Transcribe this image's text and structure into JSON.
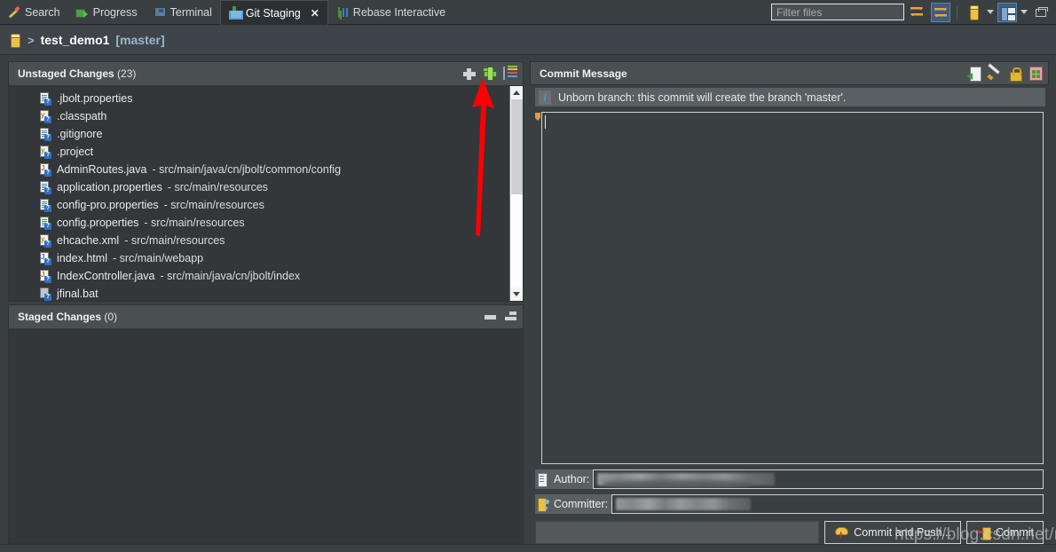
{
  "window": {
    "tabs": [
      {
        "label": "Search",
        "icon": "search-icon",
        "active": false,
        "closable": false
      },
      {
        "label": "Progress",
        "icon": "progress-icon",
        "active": false,
        "closable": false
      },
      {
        "label": "Terminal",
        "icon": "terminal-icon",
        "active": false,
        "closable": false
      },
      {
        "label": "Git Staging",
        "icon": "git-staging-icon",
        "active": true,
        "closable": true,
        "close_label": "✕"
      },
      {
        "label": "Rebase Interactive",
        "icon": "rebase-interactive-icon",
        "active": false,
        "closable": false
      }
    ],
    "toolbar": {
      "filter_placeholder": "Filter files",
      "filter_value": "",
      "buttons": [
        {
          "name": "refresh-sync-icon",
          "label": "Refresh"
        },
        {
          "name": "link-selection-icon",
          "label": "Link with Editor and Selection"
        },
        {
          "name": "repository-icon",
          "label": "Repository"
        },
        {
          "name": "repository-dropdown-caret",
          "label": "Repository menu"
        },
        {
          "name": "layout-toggle-icon",
          "label": "Column Layout"
        },
        {
          "name": "view-menu-caret",
          "label": "View Menu"
        },
        {
          "name": "minimize-icon",
          "label": "Minimize"
        }
      ]
    }
  },
  "breadcrumb": {
    "repo_icon": "repository-icon",
    "separator": ">",
    "repository": "test_demo1",
    "branch": "[master]"
  },
  "unstaged": {
    "title": "Unstaged Changes",
    "count": "(23)",
    "tools": [
      {
        "name": "add-selected-button",
        "label": "Add selected files to index"
      },
      {
        "name": "add-all-button",
        "label": "Add all files to index"
      },
      {
        "name": "sort-presentation-button",
        "label": "Presentation"
      }
    ],
    "files": [
      {
        "name": ".jbolt.properties",
        "path": "",
        "icon": "properties-file-icon",
        "status": "untracked"
      },
      {
        "name": ".classpath",
        "path": "",
        "icon": "xml-file-icon",
        "status": "untracked"
      },
      {
        "name": ".gitignore",
        "path": "",
        "icon": "properties-file-icon",
        "status": "untracked"
      },
      {
        "name": ".project",
        "path": "",
        "icon": "xml-file-icon",
        "status": "untracked"
      },
      {
        "name": "AdminRoutes.java",
        "path": " - src/main/java/cn/jbolt/common/config",
        "icon": "java-file-icon",
        "status": "untracked"
      },
      {
        "name": "application.properties",
        "path": " - src/main/resources",
        "icon": "properties-file-icon",
        "status": "untracked"
      },
      {
        "name": "config-pro.properties",
        "path": " - src/main/resources",
        "icon": "properties-file-icon",
        "status": "untracked"
      },
      {
        "name": "config.properties",
        "path": " - src/main/resources",
        "icon": "properties-file-icon",
        "status": "untracked"
      },
      {
        "name": "ehcache.xml",
        "path": " - src/main/resources",
        "icon": "xml-file-icon",
        "status": "untracked"
      },
      {
        "name": "index.html",
        "path": " - src/main/webapp",
        "icon": "html-file-icon",
        "status": "untracked"
      },
      {
        "name": "IndexController.java",
        "path": " - src/main/java/cn/jbolt/index",
        "icon": "java-file-icon",
        "status": "untracked"
      },
      {
        "name": "jfinal.bat",
        "path": "",
        "icon": "bat-file-icon",
        "status": "untracked"
      }
    ],
    "scrollbar": {
      "up_arrow": "scroll-up",
      "down_arrow": "scroll-down"
    }
  },
  "staged": {
    "title": "Staged Changes",
    "count": "(0)",
    "tools": [
      {
        "name": "remove-selected-button",
        "label": "Remove selected files from index"
      },
      {
        "name": "remove-all-button",
        "label": "Remove all files from index"
      }
    ],
    "files": []
  },
  "commit": {
    "title": "Commit Message",
    "tools": [
      {
        "name": "amend-commit-button",
        "label": "Amend Previous Commit"
      },
      {
        "name": "signed-off-button",
        "label": "Add Signed-off-by"
      },
      {
        "name": "sign-commit-button",
        "label": "Sign Commit"
      },
      {
        "name": "change-id-button",
        "label": "Add Change-Id"
      }
    ],
    "info_banner": {
      "icon": "info-icon",
      "text": "Unborn branch: this commit will create the branch 'master'."
    },
    "message_value": "",
    "author": {
      "icon": "author-icon",
      "label": "Author:",
      "value": ""
    },
    "committer": {
      "icon": "committer-icon",
      "label": "Committer:",
      "value": ""
    },
    "status_value": "",
    "buttons": {
      "commit_and_push": "Commit and Push...",
      "commit": "Commit"
    }
  },
  "annotation": {
    "arrow": {
      "color": "#ff0000",
      "points_to": "add-all-button"
    },
    "watermark": "https://blog.csdn.net/map_cx"
  }
}
